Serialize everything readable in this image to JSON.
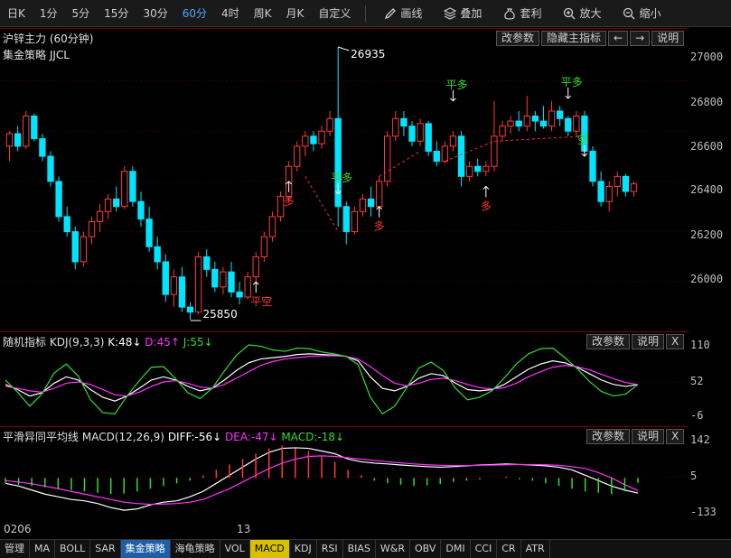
{
  "toolbar": {
    "periods": [
      "日K",
      "1分",
      "5分",
      "15分",
      "30分",
      "60分",
      "4时",
      "周K",
      "月K",
      "自定义"
    ],
    "active_period": "60分",
    "tools": [
      "画线",
      "叠加",
      "套利",
      "放大",
      "缩小"
    ]
  },
  "main_panel": {
    "title": "沪锌主力 (60分钟)",
    "strategy": "集金策略 JJCL",
    "buttons": [
      "改参数",
      "隐藏主指标",
      "←",
      "→",
      "说明"
    ],
    "y_ticks": [
      "27000",
      "26800",
      "26600",
      "26400",
      "26200",
      "26000"
    ],
    "high_label": "26935",
    "low_label": "25850",
    "signals": [
      {
        "text": "平空",
        "color": "#ff3333"
      },
      {
        "text": "多",
        "color": "#ff3333"
      },
      {
        "text": "平多",
        "color": "#33dd33"
      },
      {
        "text": "多",
        "color": "#ff3333"
      },
      {
        "text": "平多",
        "color": "#33dd33"
      },
      {
        "text": "多",
        "color": "#ff3333"
      },
      {
        "text": "平多",
        "color": "#33dd33"
      },
      {
        "text": "空",
        "color": "#33dd33"
      }
    ]
  },
  "kdj_panel": {
    "title": "随机指标",
    "params": "KDJ(9,3,3)",
    "k_label": "K:48↓",
    "d_label": "D:45↑",
    "j_label": "J:55↓",
    "buttons": [
      "改参数",
      "说明",
      "X"
    ],
    "y_ticks": [
      "110",
      "52",
      "-6"
    ]
  },
  "macd_panel": {
    "title": "平滑异同平均线",
    "params": "MACD(12,26,9)",
    "diff_label": "DIFF:-56↓",
    "dea_label": "DEA:-47↓",
    "macd_label": "MACD:-18↓",
    "buttons": [
      "改参数",
      "说明",
      "X"
    ],
    "y_ticks": [
      "142",
      "5",
      "-133"
    ]
  },
  "x_labels": [
    "0206",
    "13"
  ],
  "bottom_tabs": [
    "管理",
    "MA",
    "BOLL",
    "SAR",
    "集金策略",
    "海龟策略",
    "VOL",
    "MACD",
    "KDJ",
    "RSI",
    "BIAS",
    "W&R",
    "OBV",
    "DMI",
    "CCI",
    "CR",
    "ATR"
  ],
  "colors": {
    "up": "#ff3b3b",
    "down": "#00e5ff",
    "k_line": "#ffffff",
    "d_line": "#ff33ff",
    "j_line": "#33dd33",
    "active_tab": "#1e5fa8",
    "highlight_tab": "#d9c100"
  },
  "chart_data": [
    {
      "type": "candlestick",
      "title": "沪锌主力 (60分钟)",
      "ylim": [
        25850,
        26935
      ],
      "candles": [
        [
          26540,
          26600,
          26480,
          26590
        ],
        [
          26590,
          26620,
          26520,
          26540
        ],
        [
          26540,
          26680,
          26530,
          26660
        ],
        [
          26660,
          26670,
          26560,
          26570
        ],
        [
          26570,
          26590,
          26480,
          26500
        ],
        [
          26500,
          26520,
          26380,
          26400
        ],
        [
          26400,
          26420,
          26240,
          26260
        ],
        [
          26260,
          26300,
          26180,
          26200
        ],
        [
          26200,
          26220,
          26050,
          26080
        ],
        [
          26080,
          26200,
          26060,
          26180
        ],
        [
          26180,
          26260,
          26150,
          26240
        ],
        [
          26240,
          26310,
          26200,
          26280
        ],
        [
          26280,
          26350,
          26250,
          26330
        ],
        [
          26330,
          26380,
          26280,
          26300
        ],
        [
          26300,
          26460,
          26290,
          26440
        ],
        [
          26440,
          26460,
          26300,
          26320
        ],
        [
          26320,
          26360,
          26220,
          26250
        ],
        [
          26250,
          26300,
          26120,
          26140
        ],
        [
          26140,
          26180,
          26050,
          26080
        ],
        [
          26080,
          26110,
          25920,
          25950
        ],
        [
          25950,
          26050,
          25900,
          26020
        ],
        [
          26020,
          26060,
          25880,
          25900
        ],
        [
          25900,
          25920,
          25850,
          25880
        ],
        [
          25880,
          26120,
          25870,
          26100
        ],
        [
          26100,
          26130,
          26020,
          26050
        ],
        [
          26050,
          26080,
          25960,
          25980
        ],
        [
          25980,
          26060,
          25950,
          26040
        ],
        [
          26040,
          26080,
          25940,
          25960
        ],
        [
          25960,
          26000,
          25910,
          25940
        ],
        [
          25940,
          26040,
          25930,
          26020
        ],
        [
          26020,
          26120,
          26000,
          26100
        ],
        [
          26100,
          26200,
          26080,
          26180
        ],
        [
          26180,
          26280,
          26160,
          26260
        ],
        [
          26260,
          26360,
          26240,
          26340
        ],
        [
          26340,
          26480,
          26320,
          26460
        ],
        [
          26460,
          26560,
          26440,
          26540
        ],
        [
          26540,
          26600,
          26500,
          26580
        ],
        [
          26580,
          26600,
          26520,
          26550
        ],
        [
          26550,
          26620,
          26530,
          26600
        ],
        [
          26600,
          26680,
          26580,
          26650
        ],
        [
          26650,
          26935,
          26220,
          26300
        ],
        [
          26300,
          26320,
          26150,
          26200
        ],
        [
          26200,
          26300,
          26190,
          26280
        ],
        [
          26280,
          26350,
          26260,
          26330
        ],
        [
          26330,
          26380,
          26260,
          26300
        ],
        [
          26300,
          26420,
          26280,
          26400
        ],
        [
          26400,
          26600,
          26380,
          26580
        ],
        [
          26580,
          26680,
          26560,
          26650
        ],
        [
          26650,
          26680,
          26580,
          26620
        ],
        [
          26620,
          26640,
          26540,
          26560
        ],
        [
          26560,
          26650,
          26540,
          26630
        ],
        [
          26630,
          26640,
          26500,
          26520
        ],
        [
          26520,
          26560,
          26460,
          26480
        ],
        [
          26480,
          26560,
          26470,
          26540
        ],
        [
          26540,
          26600,
          26520,
          26580
        ],
        [
          26580,
          26600,
          26380,
          26420
        ],
        [
          26420,
          26480,
          26400,
          26460
        ],
        [
          26460,
          26490,
          26420,
          26440
        ],
        [
          26440,
          26480,
          26420,
          26460
        ],
        [
          26460,
          26720,
          26440,
          26580
        ],
        [
          26580,
          26640,
          26560,
          26620
        ],
        [
          26620,
          26660,
          26590,
          26640
        ],
        [
          26640,
          26680,
          26600,
          26620
        ],
        [
          26620,
          26740,
          26600,
          26660
        ],
        [
          26660,
          26680,
          26600,
          26640
        ],
        [
          26640,
          26700,
          26610,
          26620
        ],
        [
          26620,
          26720,
          26600,
          26680
        ],
        [
          26680,
          26700,
          26620,
          26650
        ],
        [
          26650,
          26660,
          26580,
          26600
        ],
        [
          26600,
          26680,
          26580,
          26660
        ],
        [
          26660,
          26680,
          26500,
          26520
        ],
        [
          26520,
          26540,
          26380,
          26400
        ],
        [
          26400,
          26440,
          26300,
          26320
        ],
        [
          26320,
          26400,
          26280,
          26380
        ],
        [
          26380,
          26440,
          26340,
          26420
        ],
        [
          26420,
          26430,
          26340,
          26360
        ],
        [
          26360,
          26400,
          26340,
          26390
        ]
      ]
    },
    {
      "type": "line",
      "title": "随机指标",
      "ylim": [
        -6,
        110
      ],
      "series": [
        {
          "name": "K",
          "values": [
            48,
            40,
            30,
            35,
            50,
            60,
            55,
            40,
            28,
            22,
            30,
            42,
            55,
            60,
            55,
            45,
            38,
            42,
            55,
            70,
            82,
            88,
            90,
            92,
            95,
            96,
            95,
            94,
            92,
            85,
            60,
            42,
            38,
            45,
            58,
            65,
            62,
            50,
            40,
            38,
            40,
            48,
            60,
            72,
            80,
            85,
            82,
            75,
            65,
            55,
            48,
            45,
            48
          ]
        },
        {
          "name": "D",
          "values": [
            45,
            42,
            38,
            36,
            42,
            50,
            52,
            48,
            40,
            32,
            30,
            36,
            45,
            52,
            54,
            50,
            44,
            42,
            48,
            58,
            68,
            78,
            84,
            88,
            90,
            92,
            93,
            93,
            92,
            88,
            76,
            62,
            50,
            46,
            50,
            56,
            58,
            54,
            48,
            43,
            41,
            43,
            50,
            60,
            68,
            75,
            78,
            76,
            71,
            64,
            57,
            51,
            48
          ]
        },
        {
          "name": "J",
          "values": [
            55,
            36,
            14,
            33,
            66,
            80,
            61,
            24,
            4,
            2,
            30,
            54,
            75,
            76,
            57,
            35,
            26,
            42,
            69,
            94,
            110,
            108,
            102,
            100,
            105,
            104,
            99,
            96,
            92,
            79,
            28,
            2,
            14,
            43,
            74,
            83,
            70,
            42,
            24,
            28,
            38,
            58,
            80,
            96,
            104,
            105,
            90,
            73,
            53,
            37,
            30,
            33,
            48
          ]
        }
      ]
    },
    {
      "type": "line",
      "title": "平滑异同平均线",
      "ylim": [
        -133,
        142
      ],
      "series": [
        {
          "name": "DIFF",
          "values": [
            -20,
            -30,
            -45,
            -60,
            -70,
            -80,
            -85,
            -95,
            -110,
            -120,
            -115,
            -100,
            -90,
            -85,
            -70,
            -50,
            -20,
            10,
            40,
            70,
            95,
            110,
            112,
            110,
            100,
            90,
            70,
            60,
            55,
            52,
            48,
            45,
            42,
            40,
            42,
            45,
            48,
            50,
            52,
            50,
            48,
            45,
            40,
            30,
            10,
            -10,
            -30,
            -45,
            -56
          ]
        },
        {
          "name": "DEA",
          "values": [
            -10,
            -15,
            -22,
            -30,
            -40,
            -50,
            -60,
            -70,
            -80,
            -90,
            -95,
            -98,
            -97,
            -95,
            -90,
            -80,
            -60,
            -40,
            -15,
            10,
            35,
            55,
            70,
            80,
            82,
            80,
            75,
            70,
            65,
            60,
            56,
            52,
            49,
            47,
            46,
            46,
            47,
            48,
            49,
            50,
            50,
            49,
            47,
            42,
            35,
            20,
            0,
            -25,
            -47
          ]
        },
        {
          "name": "MACD",
          "values": [
            -18,
            -25,
            -30,
            -35,
            -40,
            -45,
            -50,
            -55,
            -60,
            -58,
            -50,
            -40,
            -30,
            -20,
            -10,
            10,
            30,
            50,
            70,
            90,
            110,
            120,
            110,
            100,
            80,
            60,
            30,
            10,
            -10,
            -20,
            -25,
            -30,
            -28,
            -22,
            -15,
            -10,
            -5,
            0,
            5,
            -5,
            -10,
            -20,
            -30,
            -40,
            -50,
            -55,
            -60,
            -50,
            -18
          ]
        }
      ]
    }
  ]
}
